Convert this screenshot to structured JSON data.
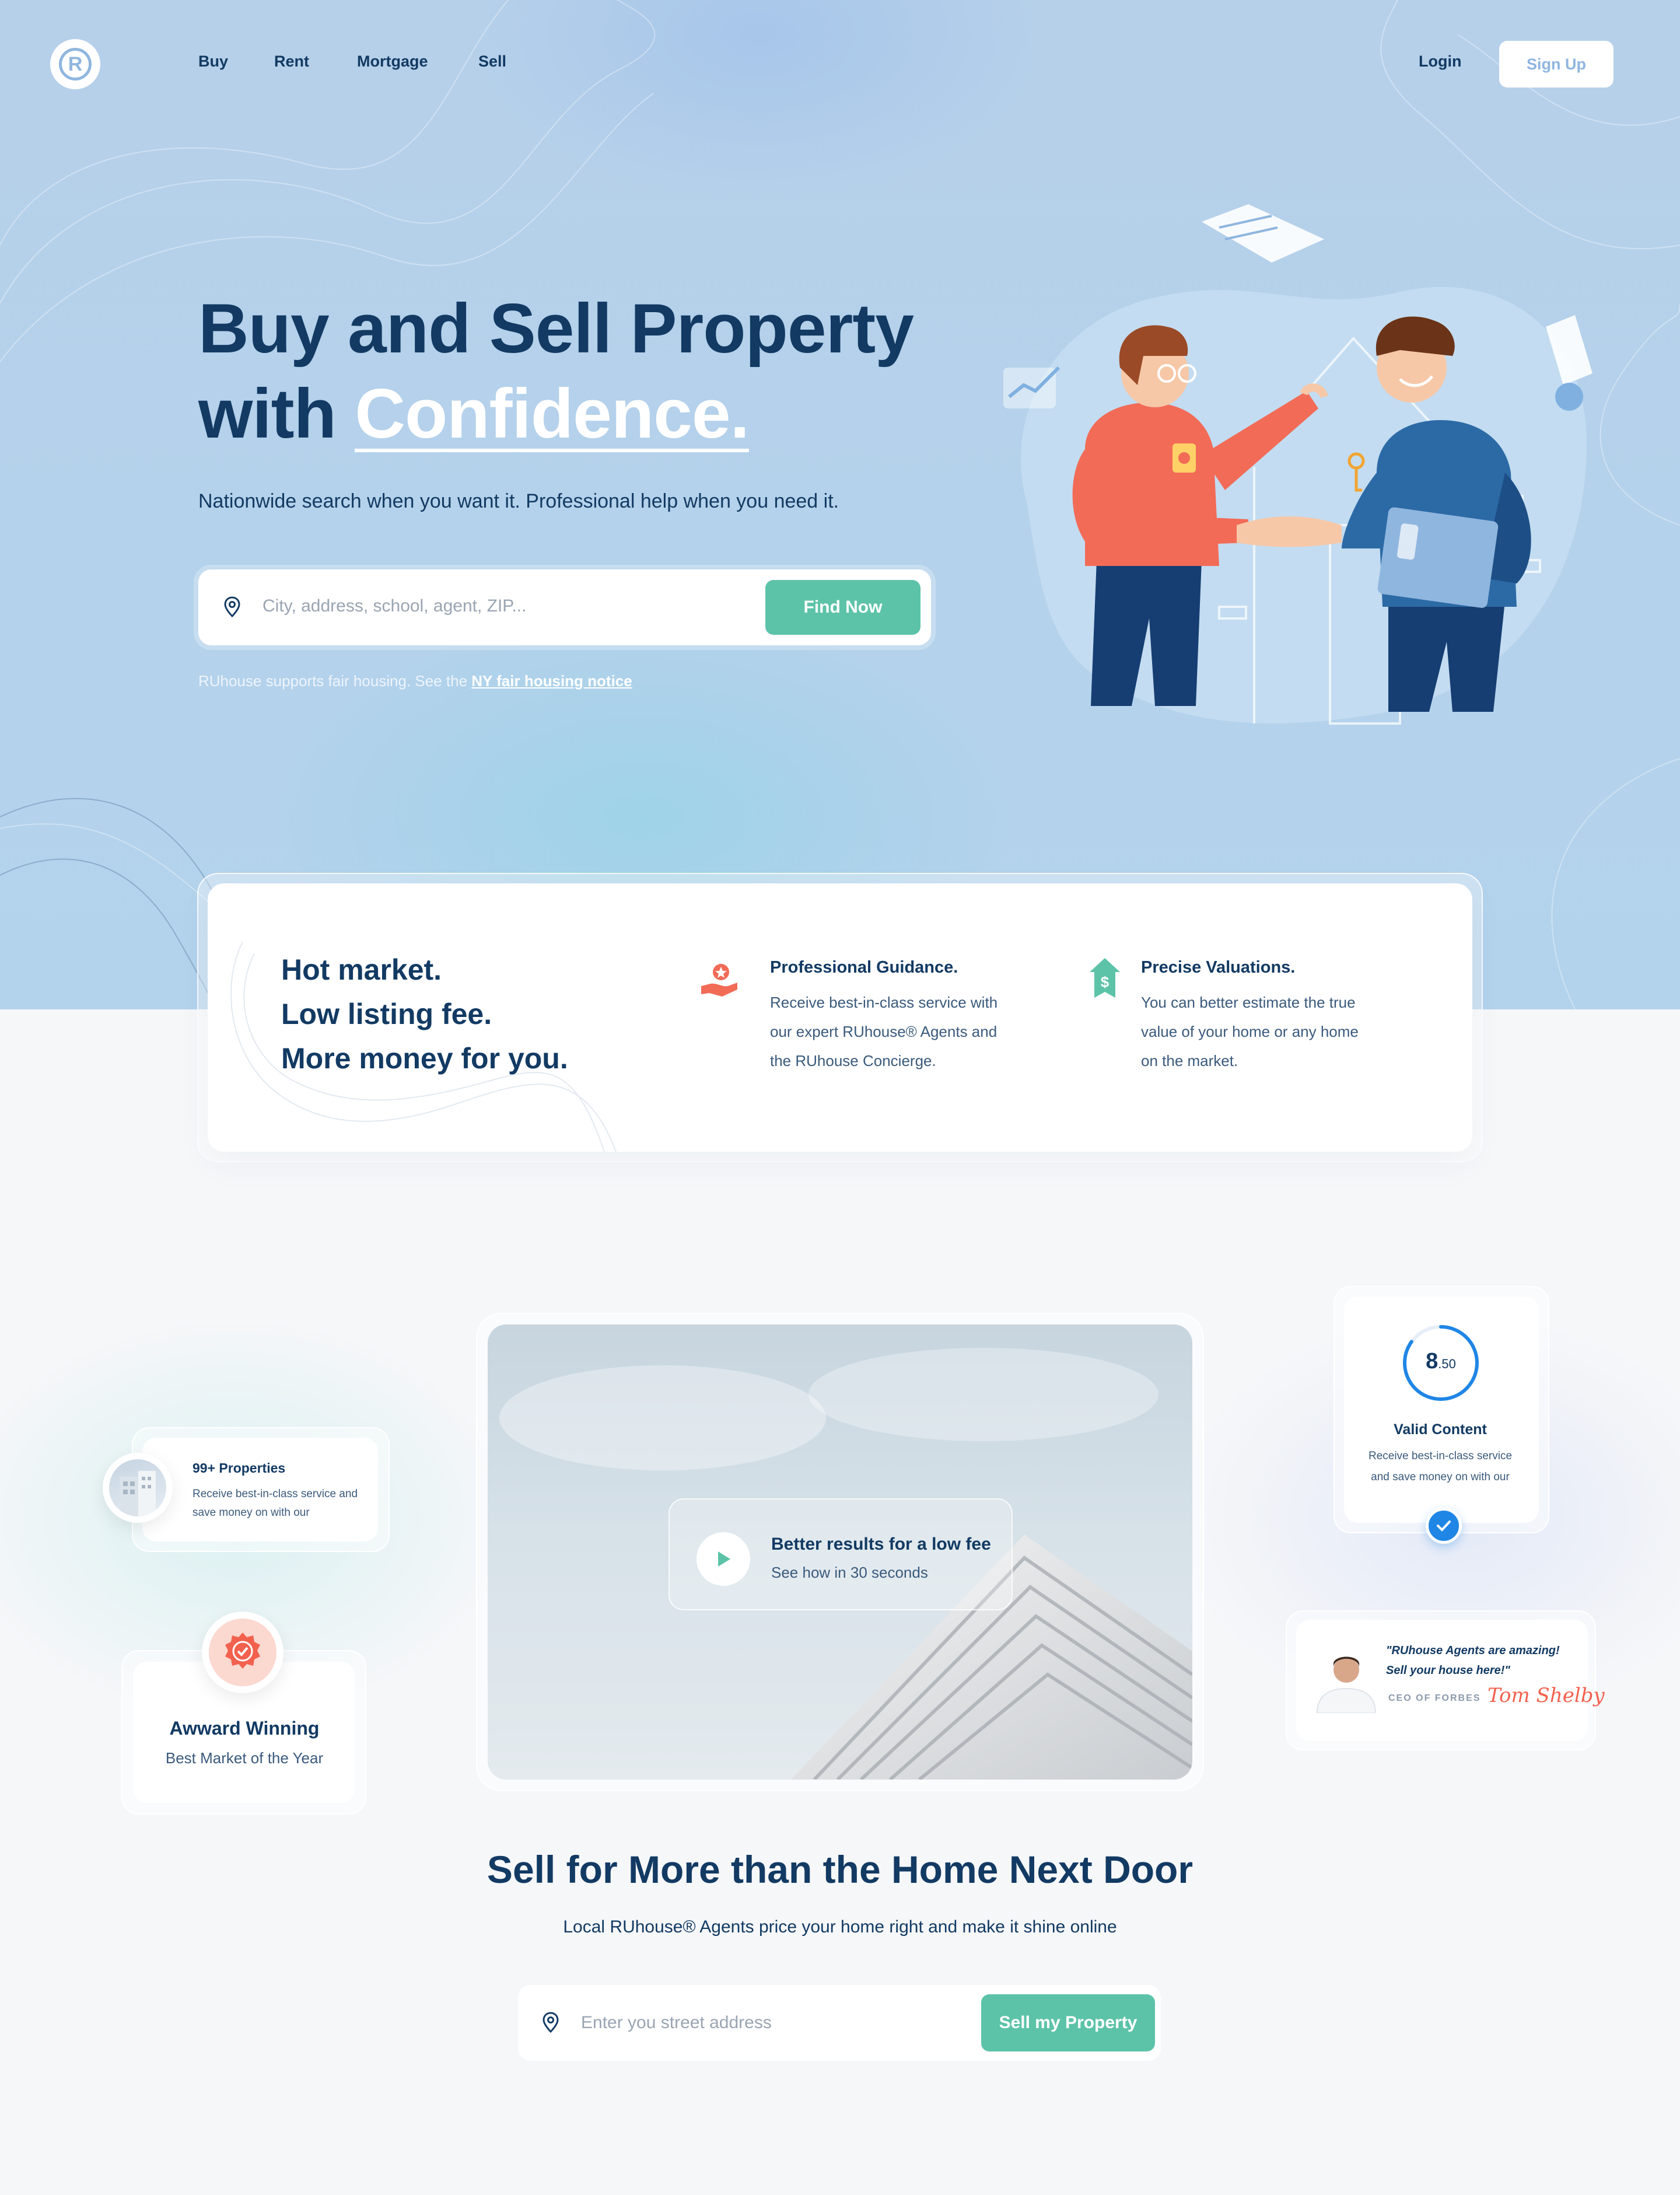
{
  "nav": {
    "links": [
      "Buy",
      "Rent",
      "Mortgage",
      "Sell"
    ],
    "login": "Login",
    "signup": "Sign Up"
  },
  "hero": {
    "title_line1": "Buy and Sell Property",
    "title_line2_prefix": "with ",
    "title_line2_accent": "Confidence.",
    "subtitle": "Nationwide search when you want it. Professional help when you need it.",
    "search_placeholder": "City, address, school, agent, ZIP...",
    "search_button": "Find Now",
    "fair_text": "RUhouse supports fair housing. See the ",
    "fair_link": "NY fair housing notice"
  },
  "features": {
    "headline": [
      "Hot market.",
      "Low listing fee.",
      "More money for you."
    ],
    "items": [
      {
        "title": "Professional Guidance.",
        "text": "Receive best-in-class service with our expert RUhouse® Agents and the RUhouse Concierge."
      },
      {
        "title": "Precise Valuations.",
        "text": "You can better estimate the true value of your home or any home on the market."
      }
    ]
  },
  "video": {
    "title": "Better results for a low fee",
    "subtitle": "See how in 30 seconds"
  },
  "properties_card": {
    "title": "99+ Properties",
    "text": "Receive best-in-class service and save money on with our"
  },
  "award_card": {
    "title": "Awward Winning",
    "subtitle": "Best Market of the Year"
  },
  "valid_card": {
    "score_main": "8",
    "score_decimal": ".50",
    "score_progress": 0.85,
    "title": "Valid Content",
    "text": "Receive best-in-class service and save money on with our"
  },
  "testimonial": {
    "quote_line1": "\"RUhouse Agents are amazing!",
    "quote_line2": "Sell your house here!\"",
    "role": "CEO OF FORBES",
    "signature": "Tom Shelby"
  },
  "sell": {
    "title": "Sell for More than the Home Next Door",
    "subtitle": "Local RUhouse® Agents price your home right and make it shine online",
    "placeholder": "Enter you street address",
    "button": "Sell my Property"
  },
  "colors": {
    "navy": "#123a63",
    "accent_green": "#5cc3a8",
    "hero_blue": "#b6d0ea",
    "coral": "#f2614e",
    "check_blue": "#1f86e6"
  }
}
